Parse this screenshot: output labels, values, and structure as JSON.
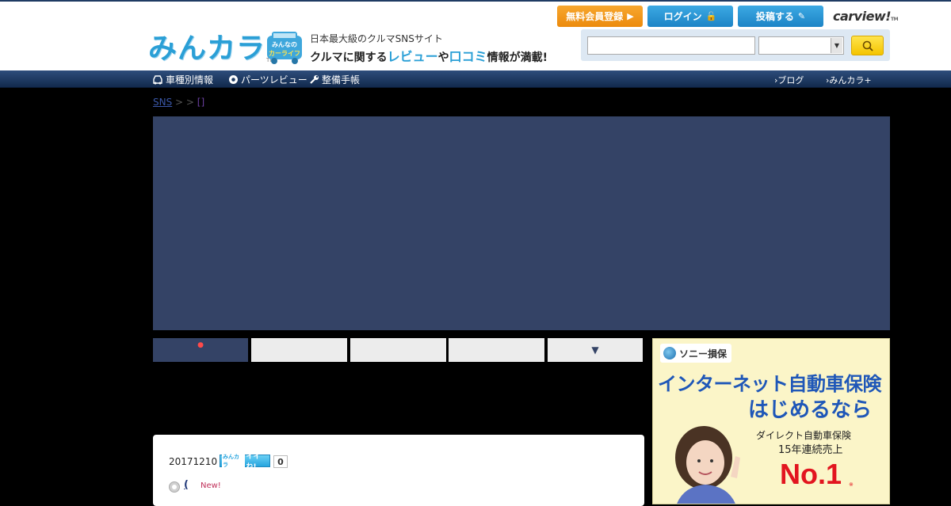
{
  "header": {
    "logo_text": "みんカラ",
    "logo_tm": "TM",
    "carlife_badge": "みんなのカーライフ",
    "tagline_top": "日本最大級のクルマSNSサイト",
    "tagline_parts": [
      "クルマに関する",
      "レビュー",
      "や",
      "口コミ",
      "情報が満載!"
    ],
    "register_label": "無料会員登録",
    "login_label": "ログイン",
    "post_label": "投稿する",
    "carview_label": "carview!",
    "carview_tm": "TM",
    "search_placeholder": "",
    "search_select_value": ""
  },
  "nav": {
    "items": [
      {
        "label": "車種別情報",
        "icon": "car-icon"
      },
      {
        "label": "パーツレビュー",
        "icon": "gear-icon"
      },
      {
        "label": "整備手帳",
        "icon": "wrench-icon"
      }
    ],
    "right": [
      "ブログ",
      "みんカラ+"
    ]
  },
  "breadcrumb": {
    "root": "SNS",
    "sep1": " > ",
    "sep2": " > ",
    "current": "[]"
  },
  "tabs": [
    {
      "label": "",
      "active": true
    },
    {
      "label": "",
      "active": false
    },
    {
      "label": "",
      "active": false
    },
    {
      "label": "",
      "active": false
    },
    {
      "label": "▼",
      "active": false
    }
  ],
  "entry": {
    "date": "20171210",
    "iine_label": "イイね!",
    "iine_mark": "みんカラ",
    "count": "0",
    "title": "(",
    "new_label": "New!"
  },
  "ad": {
    "brand": "ソニー損保",
    "line1": "インターネット自動車保険",
    "line2": "はじめるなら",
    "sub1": "ダイレクト自動車保険",
    "sub2": "15年連続売上",
    "no1": "No.1",
    "note": "※"
  },
  "colors": {
    "nav_bg": "#1f3b63",
    "banner": "#344366",
    "register": "#f39a1e",
    "login": "#2a95d3",
    "accent": "#2a9fd6",
    "ad_blue": "#1f57b8",
    "ad_red": "#e2151f"
  }
}
